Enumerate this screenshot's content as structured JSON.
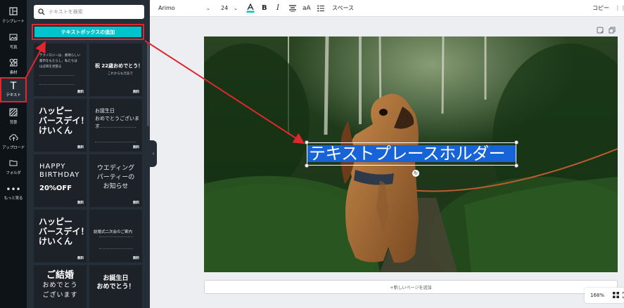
{
  "rail": {
    "items": [
      {
        "label": "テンプレート",
        "icon": "layout-icon"
      },
      {
        "label": "写真",
        "icon": "photo-icon"
      },
      {
        "label": "素材",
        "icon": "elements-icon"
      },
      {
        "label": "テキスト",
        "icon": "text-icon"
      },
      {
        "label": "背景",
        "icon": "background-icon"
      },
      {
        "label": "アップロード",
        "icon": "upload-icon"
      },
      {
        "label": "フォルダ",
        "icon": "folder-icon"
      },
      {
        "label": "もっと見る",
        "icon": "more-icon"
      }
    ],
    "active_index": 3
  },
  "panel": {
    "search_placeholder": "テキストを検索",
    "add_textbox_label": "テキストボックスの追加",
    "tiles": [
      {
        "lines": [
          "テクノロジーは、素晴らしい",
          "都市をもたらし、私たちは",
          "ほぼ目を見張る"
        ],
        "badge": "無料"
      },
      {
        "lines": [
          "祝 22歳おめでとう！",
          "これからも元気で"
        ],
        "badge": "無料"
      },
      {
        "lines": [
          "ハッピー",
          "バースデイ！",
          "けいくん"
        ],
        "badge": "無料"
      },
      {
        "lines": [
          "お誕生日",
          "おめでとうございます"
        ],
        "badge": "無料"
      },
      {
        "lines": [
          "HAPPY",
          "BIRTHDAY",
          "20%OFF"
        ],
        "badge": "無料"
      },
      {
        "lines": [
          "ウエディング",
          "パーティーの",
          "お知らせ"
        ],
        "badge": "無料"
      },
      {
        "lines": [
          "ハッピー",
          "バースデイ！",
          "けいくん"
        ],
        "badge": "無料"
      },
      {
        "lines": [
          "結婚式二次会のご案内"
        ],
        "badge": "無料"
      },
      {
        "lines": [
          "ご結婚",
          "おめでとう",
          "ございます"
        ],
        "badge": ""
      },
      {
        "lines": [
          "お誕生日",
          "おめでとう！"
        ],
        "badge": ""
      }
    ]
  },
  "toolbar": {
    "font": "Arimo",
    "size": "24",
    "bold": "B",
    "italic": "I",
    "case": "aA",
    "spacing": "スペース",
    "copy": "コピー"
  },
  "canvas": {
    "placeholder_text": "テキストプレースホルダー"
  },
  "add_page_label": "+新しいページを追加",
  "zoom_level": "168%",
  "colors": {
    "accent": "#00c4cc",
    "highlight": "#e0272d",
    "selection": "#1664d8"
  }
}
